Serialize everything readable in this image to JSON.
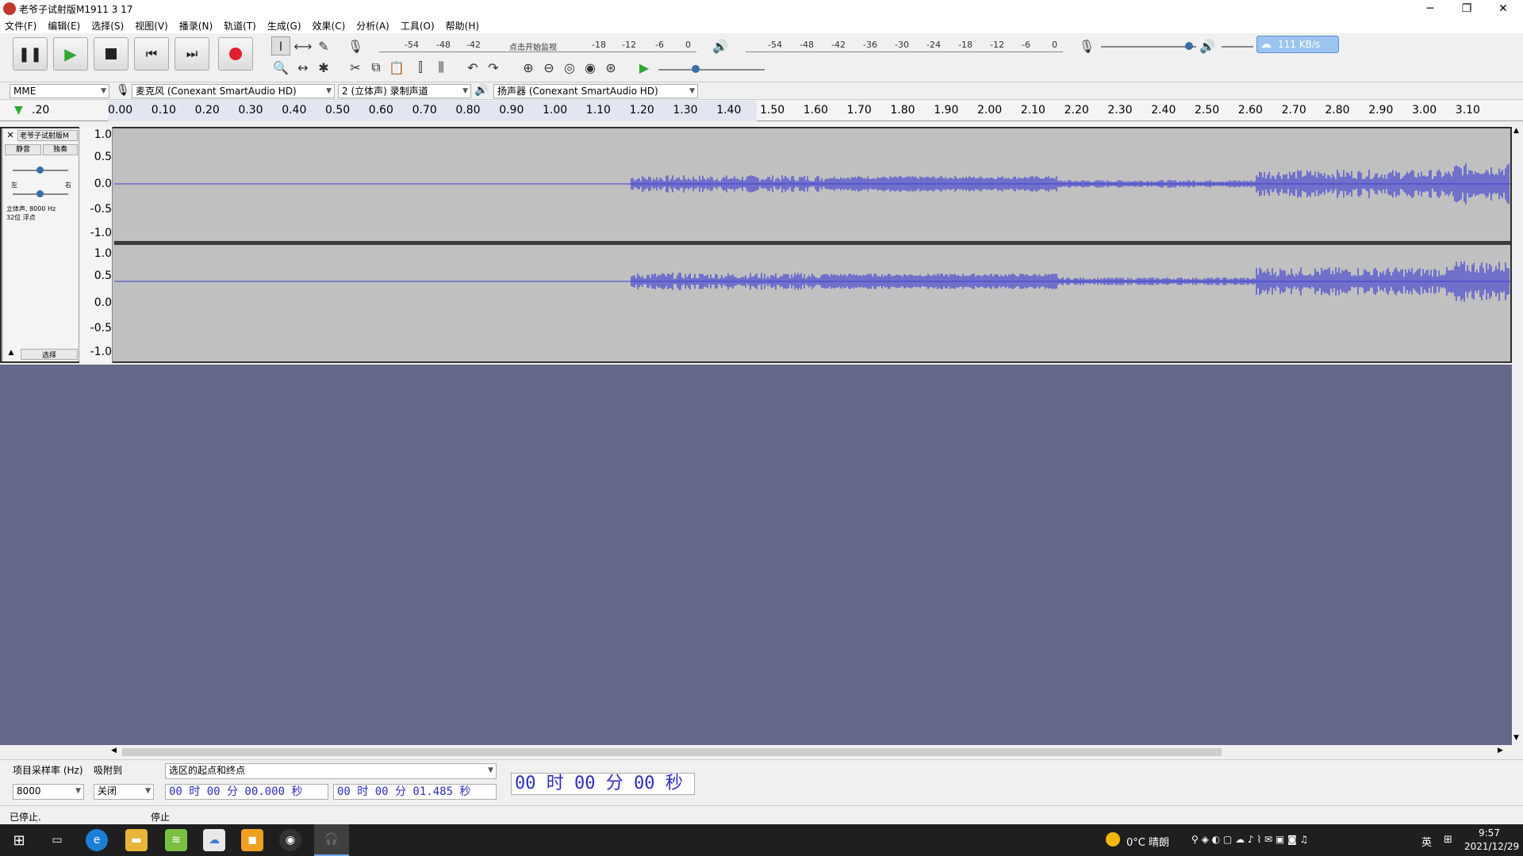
{
  "window": {
    "title": "老爷子试射版M1911 3 17"
  },
  "menu": [
    "文件(F)",
    "编辑(E)",
    "选择(S)",
    "视图(V)",
    "播录(N)",
    "轨道(T)",
    "生成(G)",
    "效果(C)",
    "分析(A)",
    "工具(O)",
    "帮助(H)"
  ],
  "meters": {
    "record_labels": [
      "-54",
      "-48",
      "-42",
      "点击开始监视",
      "-18",
      "-12",
      "-6",
      "0"
    ],
    "play_labels": [
      "-54",
      "-48",
      "-42",
      "-36",
      "-30",
      "-24",
      "-18",
      "-12",
      "-6",
      "0"
    ],
    "cloud_speed": "111 KB/s"
  },
  "devices": {
    "host": "MME",
    "mic": "麦克风 (Conexant SmartAudio HD)",
    "channels": "2 (立体声) 录制声道",
    "speaker": "扬声器 (Conexant SmartAudio HD)"
  },
  "ruler": {
    "start": ".20",
    "ticks": [
      "0.00",
      "0.10",
      "0.20",
      "0.30",
      "0.40",
      "0.50",
      "0.60",
      "0.70",
      "0.80",
      "0.90",
      "1.00",
      "1.10",
      "1.20",
      "1.30",
      "1.40",
      "1.50",
      "1.60",
      "1.70",
      "1.80",
      "1.90",
      "2.00",
      "2.10",
      "2.20",
      "2.30",
      "2.40",
      "2.50",
      "2.60",
      "2.70",
      "2.80",
      "2.90",
      "3.00",
      "3.10"
    ]
  },
  "track": {
    "name": "老爷子试射版M",
    "mute": "静音",
    "solo": "独奏",
    "pan_l": "左",
    "pan_r": "右",
    "info_line1": "立体声, 8000 Hz",
    "info_line2": "32位 浮点",
    "select": "选择",
    "y_labels": [
      "1.0",
      "0.5",
      "0.0",
      "-0.5",
      "-1.0"
    ]
  },
  "selection": {
    "rate_label": "项目采样率 (Hz)",
    "rate_value": "8000",
    "snap_label": "吸附到",
    "snap_value": "关闭",
    "mode": "选区的起点和终点",
    "start": "00 时 00 分 00.000 秒",
    "end": "00 时 00 分 01.485 秒",
    "position": "00 时 00 分 00 秒"
  },
  "status": {
    "left": "已停止.",
    "right": "停止"
  },
  "taskbar": {
    "weather": "0°C 晴朗",
    "ime": "英",
    "time": "9:57",
    "date": "2021/12/29"
  },
  "colors": {
    "wave": "#3c3cd2",
    "track_bg": "#c0c0c0",
    "empty_bg": "#646789"
  }
}
